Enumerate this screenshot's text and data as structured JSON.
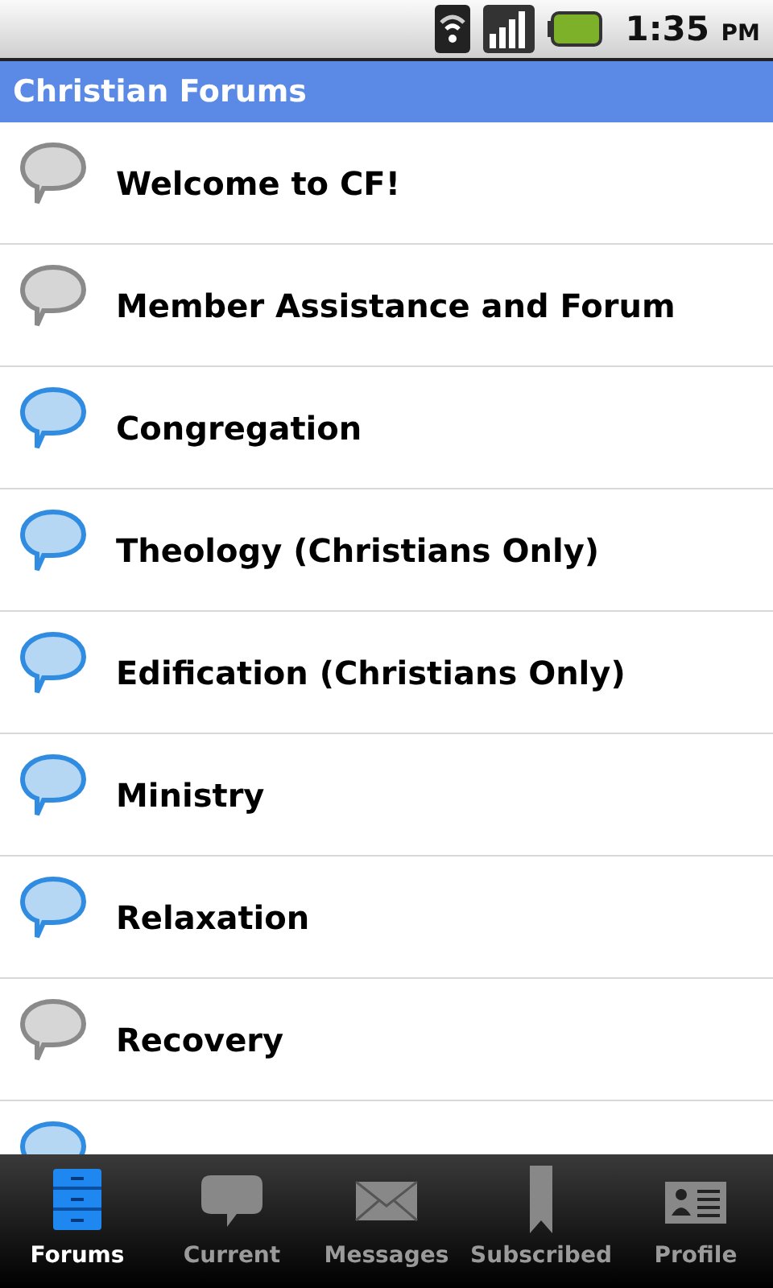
{
  "status_bar": {
    "time": "1:35",
    "period": "PM"
  },
  "title": "Christian Forums",
  "forums": [
    {
      "name": "Welcome to CF!",
      "color": "#8a8a8a"
    },
    {
      "name": "Member Assistance and Forum",
      "color": "#8a8a8a"
    },
    {
      "name": "Congregation",
      "color": "#2f8ce0"
    },
    {
      "name": "Theology (Christians Only)",
      "color": "#2f8ce0"
    },
    {
      "name": "Edification (Christians Only)",
      "color": "#2f8ce0"
    },
    {
      "name": "Ministry",
      "color": "#2f8ce0"
    },
    {
      "name": "Relaxation",
      "color": "#2f8ce0"
    },
    {
      "name": "Recovery",
      "color": "#8a8a8a"
    },
    {
      "color": "#2f8ce0"
    }
  ],
  "tabs": [
    {
      "label": "Forums",
      "kind": "drawer",
      "selected": true
    },
    {
      "label": "Current",
      "kind": "bubble",
      "selected": false
    },
    {
      "label": "Messages",
      "kind": "envelope",
      "selected": false
    },
    {
      "label": "Subscribed",
      "kind": "bookmark",
      "selected": false
    },
    {
      "label": "Profile",
      "kind": "card",
      "selected": false
    }
  ]
}
